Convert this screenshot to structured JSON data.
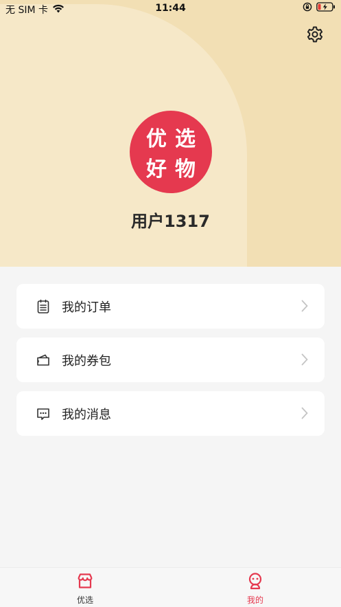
{
  "status_bar": {
    "carrier": "无 SIM 卡",
    "time": "11:44"
  },
  "header": {
    "settings_icon": "gear-icon"
  },
  "logo": {
    "chars": [
      "优",
      "选",
      "好",
      "物"
    ],
    "color": "#e5394f"
  },
  "user": {
    "name": "用户1317"
  },
  "menu": {
    "items": [
      {
        "label": "我的订单",
        "icon": "order-list-icon"
      },
      {
        "label": "我的券包",
        "icon": "wallet-icon"
      },
      {
        "label": "我的消息",
        "icon": "message-icon"
      }
    ]
  },
  "tabbar": {
    "tabs": [
      {
        "label": "优选",
        "icon": "store-icon",
        "active": false
      },
      {
        "label": "我的",
        "icon": "profile-icon",
        "active": true
      }
    ],
    "accent": "#e5394f"
  }
}
